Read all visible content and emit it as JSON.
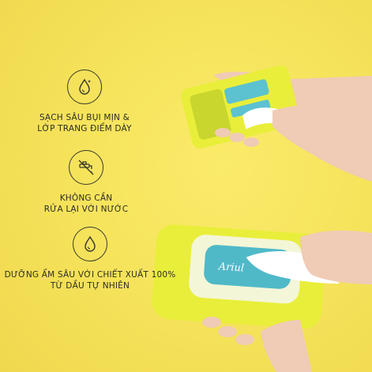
{
  "benefits": [
    {
      "icon": "drop-sparkle-icon",
      "text": "SẠCH SÂU BỤI MỊN &\nLỚP TRANG ĐIỂM DÀY"
    },
    {
      "icon": "no-faucet-icon",
      "text": "KHÔNG CẦN\nRỬA LẠI VỚI NƯỚC"
    },
    {
      "icon": "drop-icon",
      "text": "DƯỠNG ẨM SÂU VỚI CHIẾT XUẤT 100%\nTỪ DẦU TỰ NHIÊN"
    }
  ],
  "product_brand_logo": "Ariul",
  "colors": {
    "background": "#f5e25a",
    "text": "#2d2d22",
    "pack_yellow": "#e9ee3a",
    "pack_teal": "#4fb9c8",
    "wipe": "#ffffff",
    "skin": "#f1cdb8"
  }
}
